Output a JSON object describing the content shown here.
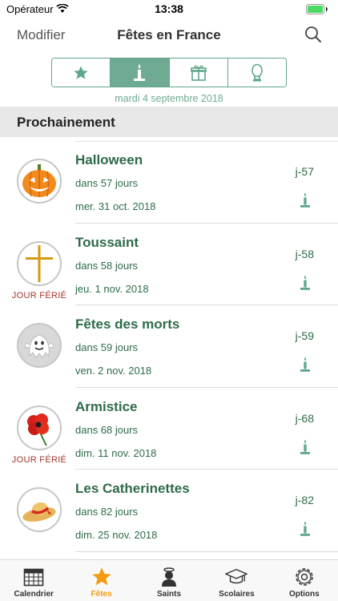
{
  "status_bar": {
    "carrier": "Opérateur",
    "time": "13:38"
  },
  "nav": {
    "left_button": "Modifier",
    "title": "Fêtes en France",
    "search_icon": "search-icon"
  },
  "segments": [
    {
      "icon": "star-icon",
      "active": false
    },
    {
      "icon": "candle-icon",
      "active": true
    },
    {
      "icon": "gift-icon",
      "active": false
    },
    {
      "icon": "bust-icon",
      "active": false
    }
  ],
  "current_date": "mardi 4 septembre 2018",
  "section_title": "Prochainement",
  "events": [
    {
      "name": "Halloween",
      "in_days": "dans 57 jours",
      "date": "mer. 31 oct. 2018",
      "countdown": "j-57",
      "icon": "pumpkin-icon",
      "badge": ""
    },
    {
      "name": "Toussaint",
      "in_days": "dans 58 jours",
      "date": "jeu. 1 nov. 2018",
      "countdown": "j-58",
      "icon": "cross-icon",
      "badge": "JOUR FÉRIÉ"
    },
    {
      "name": "Fêtes des morts",
      "in_days": "dans 59 jours",
      "date": "ven. 2 nov. 2018",
      "countdown": "j-59",
      "icon": "ghost-icon",
      "badge": ""
    },
    {
      "name": "Armistice",
      "in_days": "dans 68 jours",
      "date": "dim. 11 nov. 2018",
      "countdown": "j-68",
      "icon": "poppy-icon",
      "badge": "JOUR FÉRIÉ"
    },
    {
      "name": "Les Catherinettes",
      "in_days": "dans 82 jours",
      "date": "dim. 25 nov. 2018",
      "countdown": "j-82",
      "icon": "hat-icon",
      "badge": ""
    }
  ],
  "tabs": [
    {
      "label": "Calendrier",
      "icon": "calendar-icon",
      "active": false
    },
    {
      "label": "Fêtes",
      "icon": "star-icon",
      "active": true
    },
    {
      "label": "Saints",
      "icon": "saint-icon",
      "active": false
    },
    {
      "label": "Scolaires",
      "icon": "graduation-cap-icon",
      "active": false
    },
    {
      "label": "Options",
      "icon": "gear-icon",
      "active": false
    }
  ],
  "colors": {
    "accent": "#6fab92",
    "text_green": "#2e6b48",
    "ferie_red": "#a2362e",
    "tab_active": "#f39c12"
  }
}
